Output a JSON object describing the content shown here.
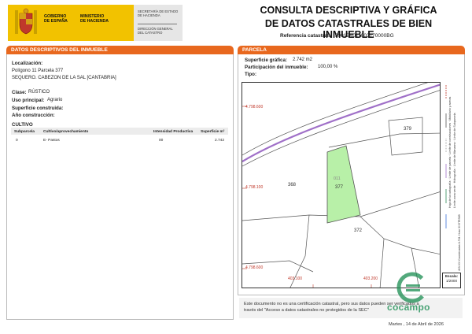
{
  "header": {
    "gov_line1": "GOBIERNO",
    "gov_line2": "DE ESPAÑA",
    "ministry_line1": "MINISTERIO",
    "ministry_line2": "DE HACIENDA",
    "secretaria_line1": "SECRETARÍA DE ESTADO",
    "secretaria_line2": "DE HACIENDA",
    "direccion_line1": "DIRECCIÓN GENERAL",
    "direccion_line2": "DEL CATASTRO",
    "title_line1": "CONSULTA DESCRIPTIVA Y GRÁFICA",
    "title_line2": "DE DATOS CATASTRALES DE BIEN INMUEBLE",
    "ref_label": "Referencia catastral:",
    "ref_value": "39012A011003770000BG"
  },
  "left_section": {
    "title": "DATOS DESCRIPTIVOS DEL INMUEBLE",
    "localizacion_label": "Localización:",
    "localizacion_line1": "Polígono 11 Parcela 377",
    "localizacion_line2": "SEQUERO. CABEZON DE LA SAL [CANTABRIA]",
    "clase_label": "Clase:",
    "clase_value": "RÚSTICO",
    "uso_label": "Uso principal:",
    "uso_value": "Agrario",
    "superficie_construida_label": "Superficie construida:",
    "ano_label": "Año construcción:",
    "cultivo_label": "CULTIVO",
    "cultivo_table": {
      "headers": [
        "Subparcela",
        "Cultivo/aprovechamiento",
        "Intensidad Productiva",
        "Superficie m²"
      ],
      "rows": [
        [
          "0",
          "E- Pastos",
          "00",
          "2.742"
        ]
      ]
    }
  },
  "right_section": {
    "title": "PARCELA",
    "superficie_label": "Superficie gráfica:",
    "superficie_value": "2.742 m2",
    "participacion_label": "Participación del inmueble:",
    "participacion_value": "100,00 %",
    "tipo_label": "Tipo:",
    "map": {
      "coord_y1": "4.798.600",
      "coord_y2": "4.798.100",
      "coord_y3": "4.798.600",
      "coord_x1": "403.100",
      "coord_x2": "403.200",
      "parcel_code": "011",
      "parcel_number": "377",
      "neighbor_379": "379",
      "neighbor_368": "368",
      "neighbor_372": "372"
    },
    "legend_lines": [
      "Hoja de la cartografía",
      "Límite de parcela",
      "Límite de construcciones",
      "Mobiliario y aceras",
      "Límite zona verde",
      "Hidrografía",
      "Límite de Manzana",
      "Límite de Subparcela"
    ],
    "vertical_ref": "403.000 Coordenadas U.T.M. Huso 30 ETRS89",
    "scale_label": "Escala:",
    "scale_value": "1/2000",
    "accent_color": "#e8681e",
    "parcel_fill": "#b8f0a8",
    "road_color": "#a070c8"
  },
  "footer": {
    "note_line1": "Este documento no es una certificación catastral, pero sus datos pueden ser verificados a",
    "note_line2": "través del \"Acceso a datos catastrales no protegidos de la SEC\"",
    "date": "Martes , 14 de Abril de 2026",
    "watermark": "cocampo"
  }
}
